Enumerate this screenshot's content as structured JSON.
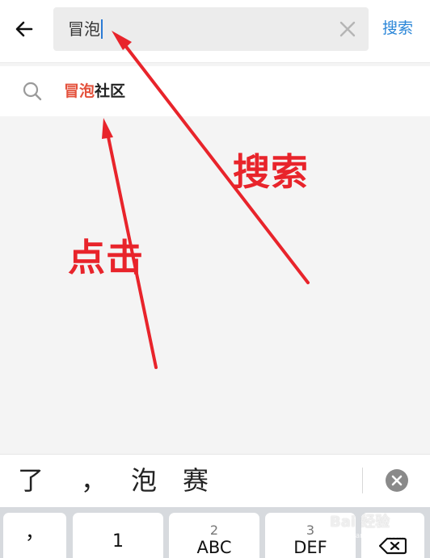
{
  "header": {
    "search_value": "冒泡",
    "search_button": "搜索"
  },
  "suggestion": {
    "highlight": "冒泡",
    "rest": "社区"
  },
  "annotations": {
    "search_label": "搜索",
    "click_label": "点击",
    "color": "#e8242b"
  },
  "candidates": [
    "了",
    "，",
    "泡",
    "赛"
  ],
  "keyboard": {
    "keys": [
      {
        "number": "",
        "label": "，"
      },
      {
        "number": "",
        "label": "1"
      },
      {
        "number": "2",
        "label": "ABC"
      },
      {
        "number": "3",
        "label": "DEF"
      },
      {
        "number": "",
        "label": "",
        "icon": "backspace-icon"
      }
    ]
  },
  "watermark": {
    "brand": "Bai 经验",
    "sub": "jingyan.baidu.com"
  },
  "colors": {
    "accent": "#2a86d8",
    "highlight": "#e4523d",
    "annotation": "#e8242b"
  }
}
